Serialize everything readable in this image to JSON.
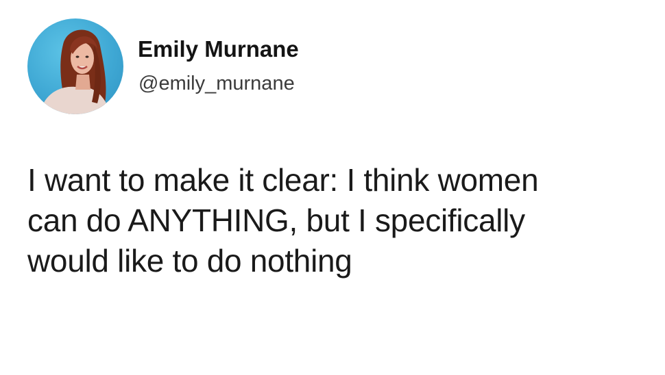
{
  "author": {
    "display_name": "Emily Murnane",
    "handle": "@emily_murnane",
    "avatar_icon": "profile-photo-avatar"
  },
  "tweet": {
    "lines": [
      "I want to make it clear: I think women",
      "can do ANYTHING, but I specifically",
      "would like to do nothing"
    ]
  },
  "colors": {
    "background": "#ffffff",
    "text": "#141414",
    "handle": "#3b3b3b",
    "avatar_bg": "#3fa8d4"
  }
}
